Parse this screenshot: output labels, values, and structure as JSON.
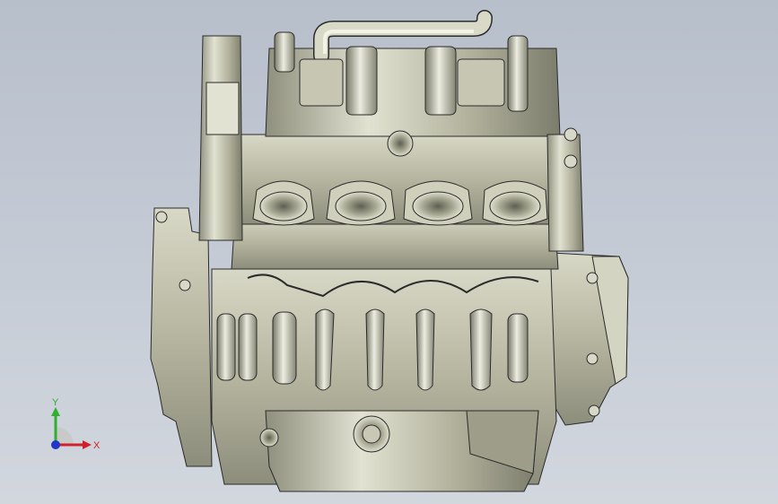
{
  "view": {
    "background_top": "#b7bfcb",
    "background_bottom": "#d2d7de"
  },
  "model": {
    "body_color": "#bdbda8",
    "shadow_color": "#6f6f5f",
    "edge_color": "#2b2b2b",
    "highlight_color": "#e6e6d6"
  },
  "triad": {
    "x_label": "X",
    "y_label": "Y",
    "x_color": "#d0202a",
    "y_color": "#2fae2f",
    "z_color": "#2036c8"
  }
}
